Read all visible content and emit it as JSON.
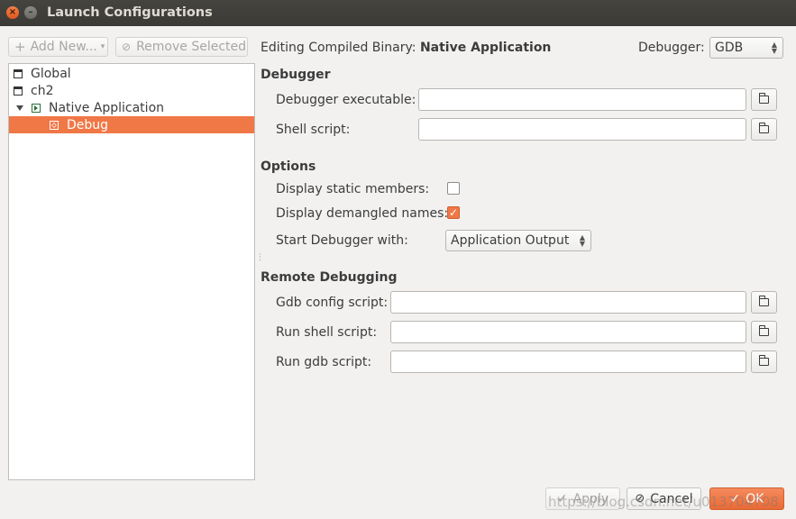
{
  "window": {
    "title": "Launch Configurations",
    "close_glyph": "×",
    "min_glyph": "–"
  },
  "toolbar": {
    "add_new_label": "Add New...",
    "remove_label": "Remove Selected"
  },
  "tree": [
    {
      "label": "Global",
      "level": 0,
      "icon": "folder-icon",
      "selected": false
    },
    {
      "label": "ch2",
      "level": 0,
      "icon": "folder-icon",
      "selected": false
    },
    {
      "label": "Native Application",
      "level": 0,
      "icon": "run-config-icon",
      "expanded": true,
      "selected": false
    },
    {
      "label": "Debug",
      "level": 1,
      "icon": "debug-config-icon",
      "selected": true
    }
  ],
  "header": {
    "editing_prefix": "Editing Compiled Binary:",
    "editing_target": "Native Application",
    "debugger_label": "Debugger:",
    "debugger_value": "GDB"
  },
  "debugger_section": {
    "title": "Debugger",
    "executable_label": "Debugger executable:",
    "executable_value": "",
    "shell_script_label": "Shell script:",
    "shell_script_value": ""
  },
  "options_section": {
    "title": "Options",
    "static_members_label": "Display static members:",
    "static_members_checked": false,
    "demangled_label": "Display demangled names:",
    "demangled_checked": true,
    "start_with_label": "Start Debugger with:",
    "start_with_value": "Application Output"
  },
  "remote_section": {
    "title": "Remote Debugging",
    "gdb_config_label": "Gdb config script:",
    "gdb_config_value": "",
    "run_shell_label": "Run shell script:",
    "run_shell_value": "",
    "run_gdb_label": "Run gdb script:",
    "run_gdb_value": ""
  },
  "footer": {
    "apply_label": "Apply",
    "cancel_label": "Cancel",
    "ok_label": "OK"
  },
  "watermark": "https://blog.csdn.net/u013704708",
  "colors": {
    "accent": "#f07746",
    "titlebar": "#3e3d39",
    "background": "#f2f1f0"
  }
}
